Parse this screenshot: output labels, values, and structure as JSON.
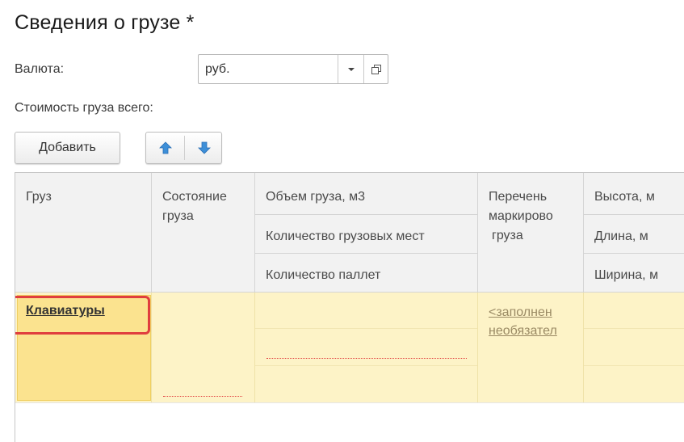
{
  "page": {
    "title": "Сведения о грузе *"
  },
  "currency": {
    "label": "Валюта:",
    "value": "руб."
  },
  "total": {
    "label": "Стоимость груза всего:"
  },
  "toolbar": {
    "add_label": "Добавить"
  },
  "table": {
    "headers": {
      "cargo": "Груз",
      "state_line1": "Состояние",
      "state_line2": "груза",
      "volume": "Объем груза, м3",
      "places": "Количество грузовых мест",
      "pallets": "Количество паллет",
      "marking_line1": "Перечень",
      "marking_line2": "маркирово",
      "marking_line3": "груза",
      "height": "Высота, м",
      "length": "Длина, м",
      "width": "Ширина, м"
    },
    "rows": [
      {
        "cargo": "Клавиатуры",
        "marking_line1": "<заполнен",
        "marking_line2": "необязател"
      }
    ]
  },
  "colors": {
    "row_highlight": "#fdf3c7",
    "selected_cell": "#fbe38f",
    "selection_border": "#e03e3e",
    "header_bg": "#f2f2f2",
    "arrow_blue": "#3d8fd8"
  },
  "icons": {
    "dropdown": "chevron-down-icon",
    "open": "open-form-icon",
    "up": "arrow-up-icon",
    "down": "arrow-down-icon"
  }
}
